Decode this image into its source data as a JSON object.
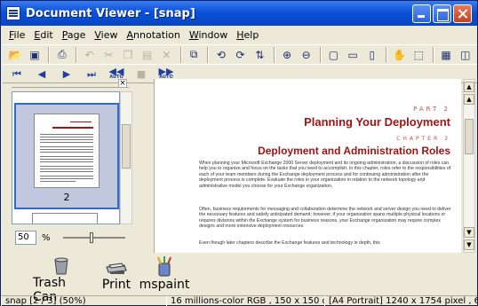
{
  "window": {
    "title": "Document Viewer - [snap]"
  },
  "menu": [
    "File",
    "Edit",
    "Page",
    "View",
    "Annotation",
    "Window",
    "Help"
  ],
  "menu_underline": [
    "F",
    "E",
    "P",
    "V",
    "A",
    "W",
    "H"
  ],
  "toolbar1_icons": [
    {
      "name": "open-folder-icon",
      "glyph": "📂"
    },
    {
      "name": "save-icon",
      "glyph": "▣"
    },
    {
      "name": "print-icon",
      "glyph": "⎙"
    },
    {
      "name": "undo-icon",
      "glyph": "↶"
    },
    {
      "name": "cut-icon",
      "glyph": "✂"
    },
    {
      "name": "copy-icon",
      "glyph": "❐"
    },
    {
      "name": "paste-icon",
      "glyph": "▤"
    },
    {
      "name": "delete-icon",
      "glyph": "✕"
    },
    {
      "name": "copy-page-icon",
      "glyph": "⧉"
    },
    {
      "name": "rotate-left-icon",
      "glyph": "⟲"
    },
    {
      "name": "rotate-right-icon",
      "glyph": "⟳"
    },
    {
      "name": "flip-icon",
      "glyph": "⇅"
    },
    {
      "name": "zoom-in-icon",
      "glyph": "⊕"
    },
    {
      "name": "zoom-out-icon",
      "glyph": "⊖"
    },
    {
      "name": "fit-page-icon",
      "glyph": "▢"
    },
    {
      "name": "fit-width-icon",
      "glyph": "▭"
    },
    {
      "name": "fit-height-icon",
      "glyph": "▯"
    },
    {
      "name": "hand-tool-icon",
      "glyph": "✋"
    },
    {
      "name": "select-tool-icon",
      "glyph": "⬚"
    },
    {
      "name": "thumbnail-view-icon",
      "glyph": "▦"
    },
    {
      "name": "split-view-icon",
      "glyph": "◫"
    }
  ],
  "toolbar2": {
    "first_label": "⏮",
    "prev_label": "◀",
    "next_label": "▶",
    "last_label": "⏭",
    "auto_back_label": "◀◀",
    "auto_sub": "AUTO",
    "stop_label": "■",
    "auto_fwd_label": "▶▶"
  },
  "thumbnails": {
    "selected_page": "2",
    "zoom_value": "50",
    "zoom_unit": "%"
  },
  "document": {
    "part": "PART 2",
    "part_title": "Planning Your Deployment",
    "chapter": "CHAPTER 3",
    "chapter_title": "Deployment and Administration Roles",
    "paragraphs": [
      "When planning your Microsoft Exchange 2000 Server deployment and its ongoing administration, a discussion of roles can help you to organize and focus on the tasks that you need to accomplish. In this chapter, roles refer to the responsibilities of each of your team members during the Exchange deployment process and for continuing administration after the deployment process is complete. Evaluate the roles in your organization in relation to the network topology and administrative model you choose for your Exchange organization.",
      "Often, business requirements for messaging and collaboration determine the network and server design you need to deliver the necessary features and satisfy anticipated demand; however, if your organization spans multiple physical locations or requires divisions within the Exchange system for business reasons, your Exchange organization may require complex designs and more extensive deployment resources.",
      "Even though later chapters describe the Exchange features and technology in depth, this"
    ]
  },
  "shortcuts": [
    {
      "label": "Trash Can",
      "icon": "trash-can-icon"
    },
    {
      "label": "Print",
      "icon": "printer-icon"
    },
    {
      "label": "mspaint",
      "icon": "paint-brushes-icon"
    }
  ],
  "status": {
    "page_info": "snap [2 / 3] (50%)",
    "color_info": "16 millions-color RGB , 150 x 150 dpi",
    "size_info": "[A4 Portrait] 1240 x 1754 pixel , 6."
  },
  "colors": {
    "title_blue": "#0a52d8",
    "heading_red": "#a01414",
    "selection_blue": "#316ac5"
  }
}
